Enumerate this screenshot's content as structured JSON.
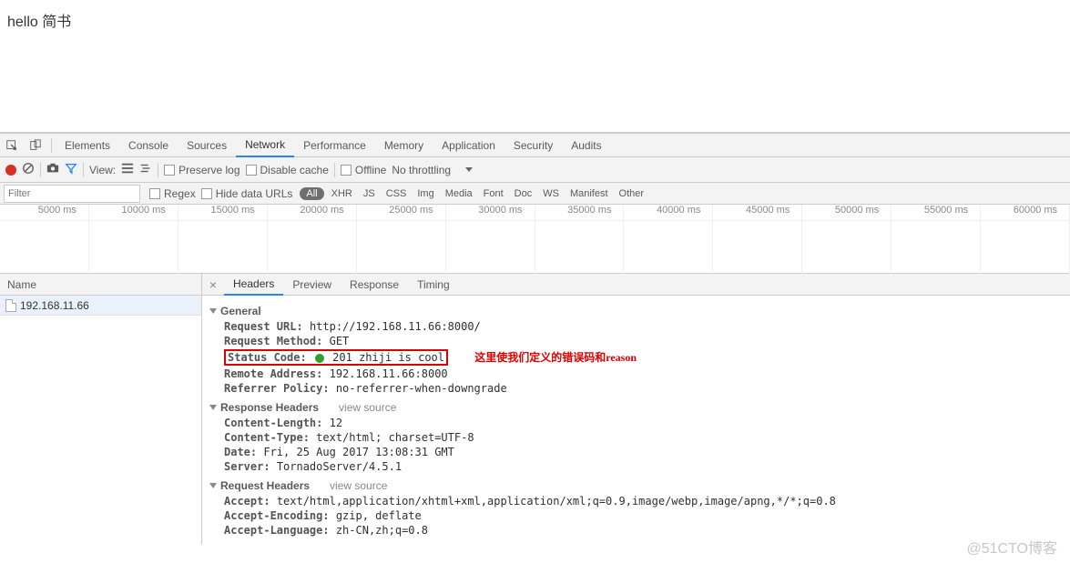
{
  "page": {
    "body_text": "hello 简书"
  },
  "tabs": {
    "elements": "Elements",
    "console": "Console",
    "sources": "Sources",
    "network": "Network",
    "performance": "Performance",
    "memory": "Memory",
    "application": "Application",
    "security": "Security",
    "audits": "Audits"
  },
  "toolbar": {
    "view_label": "View:",
    "preserve_log": "Preserve log",
    "disable_cache": "Disable cache",
    "offline": "Offline",
    "throttling": "No throttling"
  },
  "filter": {
    "placeholder": "Filter",
    "regex": "Regex",
    "hide_data_urls": "Hide data URLs",
    "all": "All",
    "types": [
      "XHR",
      "JS",
      "CSS",
      "Img",
      "Media",
      "Font",
      "Doc",
      "WS",
      "Manifest",
      "Other"
    ]
  },
  "timeline": {
    "ticks": [
      "5000 ms",
      "10000 ms",
      "15000 ms",
      "20000 ms",
      "25000 ms",
      "30000 ms",
      "35000 ms",
      "40000 ms",
      "45000 ms",
      "50000 ms",
      "55000 ms",
      "60000 ms"
    ]
  },
  "name_col": {
    "header": "Name",
    "items": [
      "192.168.11.66"
    ]
  },
  "detail_tabs": {
    "headers": "Headers",
    "preview": "Preview",
    "response": "Response",
    "timing": "Timing"
  },
  "general": {
    "title": "General",
    "request_url_k": "Request URL:",
    "request_url_v": "http://192.168.11.66:8000/",
    "request_method_k": "Request Method:",
    "request_method_v": "GET",
    "status_code_k": "Status Code:",
    "status_code_v": "201 zhiji is cool",
    "remote_addr_k": "Remote Address:",
    "remote_addr_v": "192.168.11.66:8000",
    "referrer_policy_k": "Referrer Policy:",
    "referrer_policy_v": "no-referrer-when-downgrade"
  },
  "annotation": "这里使我们定义的错误码和reason",
  "response_headers": {
    "title": "Response Headers",
    "view_source": "view source",
    "content_length_k": "Content-Length:",
    "content_length_v": "12",
    "content_type_k": "Content-Type:",
    "content_type_v": "text/html; charset=UTF-8",
    "date_k": "Date:",
    "date_v": "Fri, 25 Aug 2017 13:08:31 GMT",
    "server_k": "Server:",
    "server_v": "TornadoServer/4.5.1"
  },
  "request_headers": {
    "title": "Request Headers",
    "view_source": "view source",
    "accept_k": "Accept:",
    "accept_v": "text/html,application/xhtml+xml,application/xml;q=0.9,image/webp,image/apng,*/*;q=0.8",
    "accept_encoding_k": "Accept-Encoding:",
    "accept_encoding_v": "gzip, deflate",
    "accept_language_k": "Accept-Language:",
    "accept_language_v": "zh-CN,zh;q=0.8"
  },
  "watermark": "@51CTO博客"
}
